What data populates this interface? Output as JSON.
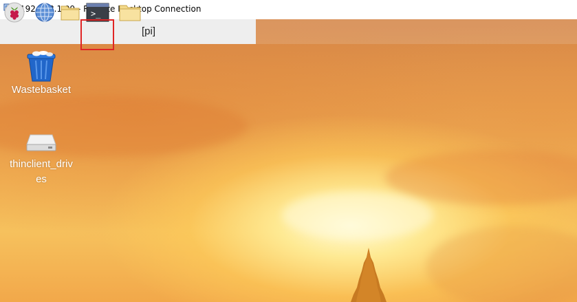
{
  "window": {
    "title": "192.168.1.99 - Remote Desktop Connection",
    "icon": "remote-desktop-icon"
  },
  "panel": {
    "items": [
      {
        "name": "raspberry-menu",
        "icon": "raspberry-icon"
      },
      {
        "name": "web-browser",
        "icon": "globe-icon"
      },
      {
        "name": "file-manager",
        "icon": "folder-icon"
      },
      {
        "name": "terminal",
        "icon": "terminal-icon",
        "highlighted": true
      },
      {
        "name": "pi-folder-window",
        "icon": "folder-icon",
        "label": "[pi]"
      }
    ],
    "terminal_prompt": ">_"
  },
  "desktop": {
    "icons": [
      {
        "label": "Wastebasket",
        "icon": "trash-icon"
      },
      {
        "label_line1": "thinclient_driv",
        "label_line2": "es",
        "icon": "drive-icon"
      }
    ]
  },
  "colors": {
    "highlight": "#e02424",
    "panel_bg": "#eeeeee",
    "sky_top": "#d58547",
    "sky_glow": "#fff5c8"
  }
}
